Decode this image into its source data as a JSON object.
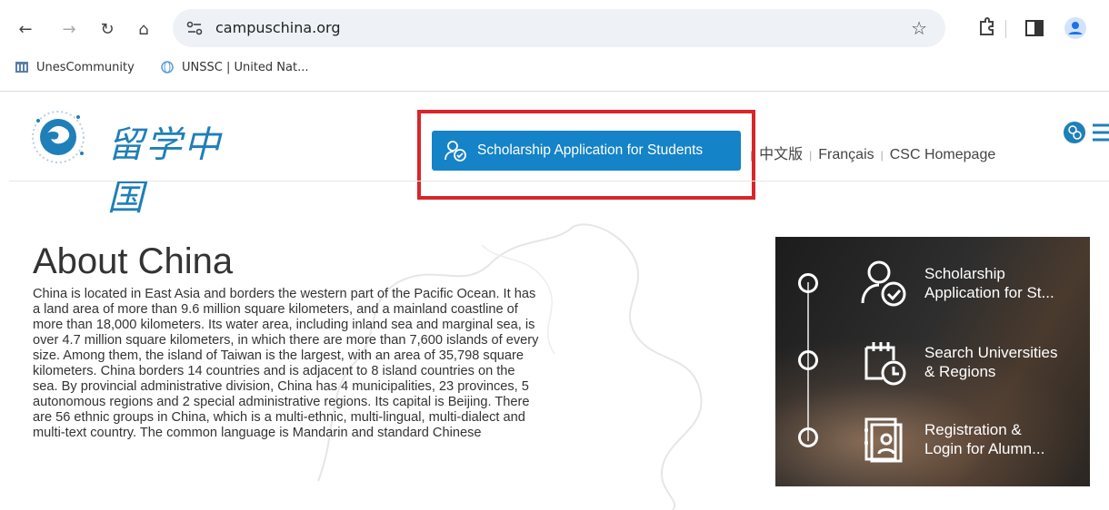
{
  "browser": {
    "url": "campuschina.org",
    "bookmarks": [
      "UnesCommunity",
      "UNSSC | United Nat..."
    ]
  },
  "site": {
    "logo_text": "留学中国",
    "apply_button": "Scholarship Application for Students",
    "links": [
      "中文版",
      "Français",
      "CSC Homepage"
    ]
  },
  "about": {
    "title": "About China",
    "body": "China is located in East Asia and borders the western part of the Pacific Ocean. It has a land area of more than 9.6 million square kilometers, and a mainland coastline of more than 18,000 kilometers. Its water area, including inland sea and marginal sea, is over 4.7 million square kilometers, in which there are more than 7,600 islands of every size. Among them, the island of Taiwan is the largest, with an area of 35,798 square kilometers. China borders 14 countries and is adjacent to 8 island countries on the sea. By provincial administrative division, China has 4 municipalities, 23 provinces, 5 autonomous regions and 2 special administrative regions. Its capital is Beijing. There are 56 ethnic groups in China, which is a multi-ethnic, multi-lingual, multi-dialect and multi-text country. The common language is Mandarin and standard Chinese"
  },
  "panel": {
    "items": [
      {
        "line1": "Scholarship",
        "line2": "Application for St..."
      },
      {
        "line1": "Search Universities",
        "line2": "& Regions"
      },
      {
        "line1": "Registration &",
        "line2": "Login for Alumn..."
      }
    ]
  },
  "colors": {
    "accent": "#1583c7",
    "highlight": "#d9262a",
    "panel": "#222222"
  }
}
